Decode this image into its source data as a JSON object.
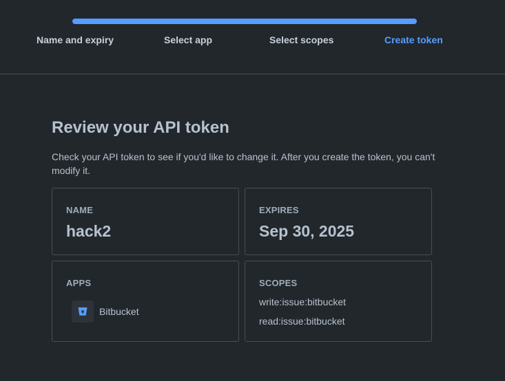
{
  "stepper": {
    "progress_fraction": 1.0,
    "steps": [
      {
        "label": "Name and expiry",
        "active": false
      },
      {
        "label": "Select app",
        "active": false
      },
      {
        "label": "Select scopes",
        "active": false
      },
      {
        "label": "Create token",
        "active": true
      }
    ]
  },
  "review": {
    "title": "Review your API token",
    "description": "Check your API token to see if you'd like to change it. After you create the token, you can't modify it."
  },
  "name_card": {
    "label": "NAME",
    "value": "hack2"
  },
  "expires_card": {
    "label": "EXPIRES",
    "value": "Sep 30, 2025"
  },
  "apps_card": {
    "label": "APPS",
    "apps": [
      {
        "name": "Bitbucket",
        "icon": "bitbucket-icon"
      }
    ]
  },
  "scopes_card": {
    "label": "SCOPES",
    "scopes": [
      "write:issue:bitbucket",
      "read:issue:bitbucket"
    ]
  },
  "colors": {
    "background": "#22272b",
    "accent": "#579dff",
    "text": "#b6c2cf",
    "muted_text": "#9fadbc",
    "border": "#454f59"
  }
}
